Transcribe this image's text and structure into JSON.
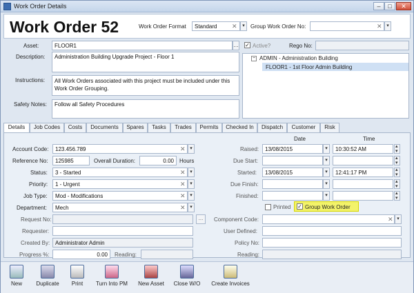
{
  "window": {
    "title": "Work Order Details"
  },
  "header": {
    "title": "Work Order 52",
    "format_label": "Work Order Format",
    "format_value": "Standard",
    "group_label": "Group Work Order No:",
    "group_value": ""
  },
  "general": {
    "asset_label": "Asset:",
    "asset_value": "FLOOR1",
    "active_label": "Active?",
    "rego_label": "Rego No:",
    "description_label": "Description:",
    "description_value": "Administration Building Upgrade Project - Floor 1",
    "instructions_label": "Instructions:",
    "instructions_value": "All Work Orders associated with this project must be included under this Work Order Grouping.",
    "safety_label": "Safety Notes:",
    "safety_value": "Follow all Safety Procedures",
    "tree": [
      {
        "toggle": "−",
        "label": "ADMIN - Administration Building"
      },
      {
        "toggle": "",
        "label": "FLOOR1 - 1st Floor Admin Building"
      }
    ]
  },
  "tabs": [
    "Details",
    "Job Codes",
    "Costs",
    "Documents",
    "Spares",
    "Tasks",
    "Trades",
    "Permits",
    "Checked In",
    "Dispatch",
    "Customer",
    "Risk"
  ],
  "details": {
    "account_code_label": "Account Code:",
    "account_code_value": "123.456.789",
    "reference_label": "Reference No:",
    "reference_value": "125985",
    "overall_duration_label": "Overall Duration:",
    "overall_duration_value": "0.00",
    "hours_label": "Hours",
    "status_label": "Status:",
    "status_value": "3 - Started",
    "priority_label": "Priority:",
    "priority_value": "1 - Urgent",
    "job_type_label": "Job Type:",
    "job_type_value": "Mod - Modifications",
    "department_label": "Department:",
    "department_value": "Mech",
    "request_label": "Request No:",
    "request_value": "",
    "requester_label": "Requester:",
    "requester_value": "",
    "created_by_label": "Created By:",
    "created_by_value": "Administrator Admin",
    "progress_label": "Progress %:",
    "progress_value": "0.00",
    "reading_label": "Reading:",
    "date_header": "Date",
    "time_header": "Time",
    "raised_label": "Raised:",
    "raised_date": "13/08/2015",
    "raised_time": "10:30:52 AM",
    "due_start_label": "Due Start:",
    "started_label": "Started:",
    "started_date": "13/08/2015",
    "started_time": "12:41:17 PM",
    "due_finish_label": "Due Finish:",
    "finished_label": "Finished:",
    "printed_label": "Printed",
    "group_wo_label": "Group Work Order",
    "component_label": "Component Code:",
    "user_defined_label": "User Defined:",
    "policy_label": "Policy No:",
    "reading2_label": "Reading:"
  },
  "toolbar": {
    "items": [
      {
        "label": "New",
        "icon": "new-icon"
      },
      {
        "label": "Duplicate",
        "icon": "duplicate-icon"
      },
      {
        "label": "Print",
        "icon": "print-icon"
      },
      {
        "label": "Turn Into PM",
        "icon": "turn-into-pm-icon"
      },
      {
        "label": "New Asset",
        "icon": "new-asset-icon"
      },
      {
        "label": "Close W/O",
        "icon": "close-wo-icon"
      },
      {
        "label": "Create Invoices",
        "icon": "create-invoices-icon"
      }
    ]
  },
  "colors": {
    "highlight": "#f3f36a",
    "accent": "#3c6db0"
  }
}
